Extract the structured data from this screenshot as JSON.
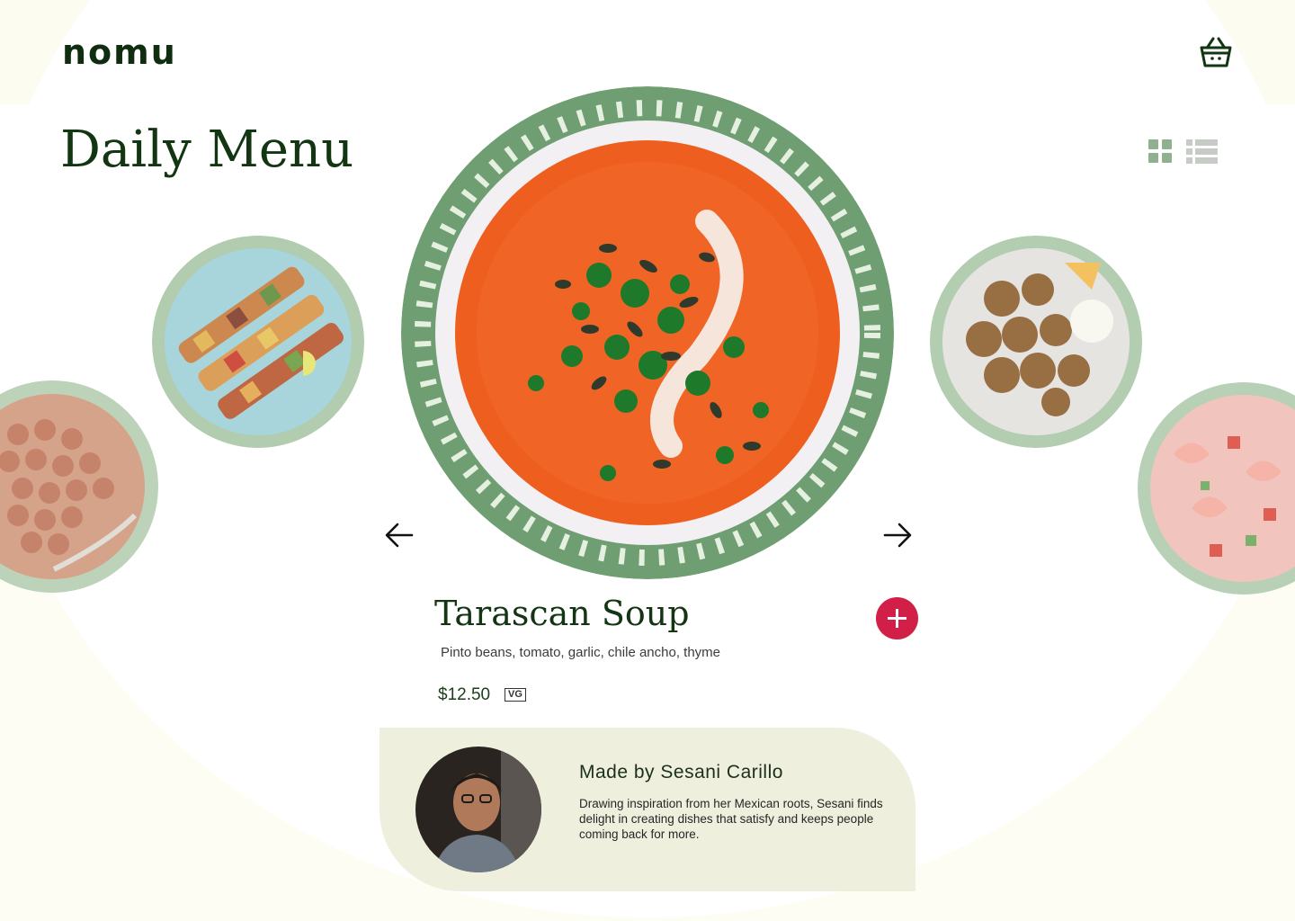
{
  "header": {
    "logo": "nomu",
    "cart_icon": "basket-icon"
  },
  "page": {
    "title": "Daily Menu",
    "view_toggle": {
      "grid_icon": "grid-view-icon",
      "list_icon": "list-view-icon"
    }
  },
  "carousel": {
    "prev_icon": "arrow-left-icon",
    "next_icon": "arrow-right-icon",
    "side_dishes": [
      "chickpeas",
      "grilled kebabs",
      "fritters",
      "shrimp ceviche"
    ]
  },
  "dish": {
    "name": "Tarascan Soup",
    "ingredients": "Pinto beans, tomato, garlic, chile ancho, thyme",
    "price": "$12.50",
    "tag": "VG",
    "add_icon": "plus-icon"
  },
  "chef": {
    "title": "Made by Sesani Carillo",
    "bio": "Drawing inspiration from her Mexican roots, Sesani finds delight in creating dishes that satisfy and keeps people coming back for more."
  },
  "colors": {
    "brand_green": "#123512",
    "plate_green": "#6f9e72",
    "accent_red": "#d21f47",
    "card_bg": "#efefde"
  }
}
